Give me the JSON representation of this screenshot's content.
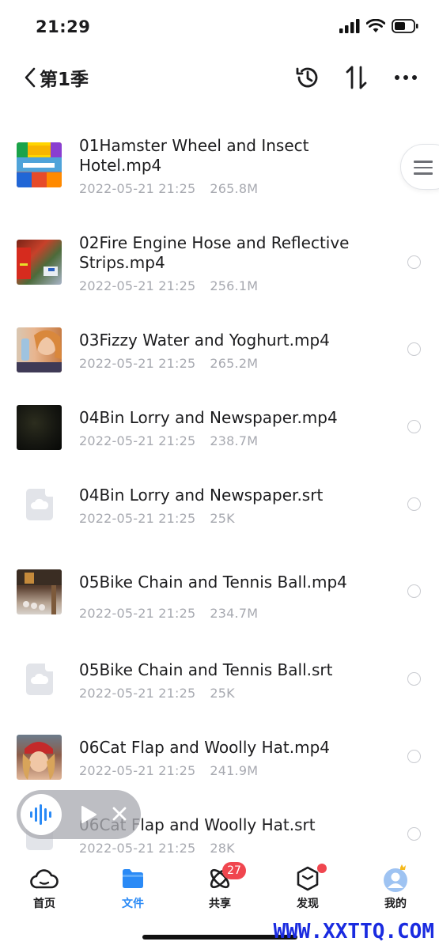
{
  "status": {
    "time": "21:29"
  },
  "nav": {
    "back_title": "第1季"
  },
  "files": [
    {
      "name_line1": "01Hamster Wheel and Insect",
      "name_line2": "Hotel.mp4",
      "date": "2022-05-21 21:25",
      "size": "265.8M",
      "type": "video"
    },
    {
      "name_line1": "02Fire Engine Hose and Reflective",
      "name_line2": "Strips.mp4",
      "date": "2022-05-21 21:25",
      "size": "256.1M",
      "type": "video"
    },
    {
      "name_line1": "03Fizzy Water and Yoghurt.mp4",
      "name_line2": "",
      "date": "2022-05-21 21:25",
      "size": "265.2M",
      "type": "video"
    },
    {
      "name_line1": "04Bin Lorry and Newspaper.mp4",
      "name_line2": "",
      "date": "2022-05-21 21:25",
      "size": "238.7M",
      "type": "video"
    },
    {
      "name_line1": "04Bin Lorry and Newspaper.srt",
      "name_line2": "",
      "date": "2022-05-21 21:25",
      "size": "25K",
      "type": "doc"
    },
    {
      "name_line1": "05Bike Chain and Tennis Ball.mp4",
      "name_line2": "",
      "date": "2022-05-21 21:25",
      "size": "234.7M",
      "type": "video"
    },
    {
      "name_line1": "05Bike Chain and Tennis Ball.srt",
      "name_line2": "",
      "date": "2022-05-21 21:25",
      "size": "25K",
      "type": "doc"
    },
    {
      "name_line1": "06Cat Flap and Woolly Hat.mp4",
      "name_line2": "",
      "date": "2022-05-21 21:25",
      "size": "241.9M",
      "type": "video"
    },
    {
      "name_line1": "06Cat Flap and Woolly Hat.srt",
      "name_line2": "",
      "date": "2022-05-21 21:25",
      "size": "28K",
      "type": "doc"
    }
  ],
  "tabs": [
    {
      "label": "首页",
      "icon": "cloud-icon"
    },
    {
      "label": "文件",
      "icon": "folder-icon"
    },
    {
      "label": "共享",
      "icon": "atom-icon",
      "badge": "27"
    },
    {
      "label": "发现",
      "icon": "cube-icon"
    },
    {
      "label": "我的",
      "icon": "avatar-icon"
    }
  ],
  "colors": {
    "accent": "#2a8af6",
    "badge": "#f0464f",
    "meta": "#a7a9b0"
  },
  "watermark": "WWW.XXTTQ.COM"
}
